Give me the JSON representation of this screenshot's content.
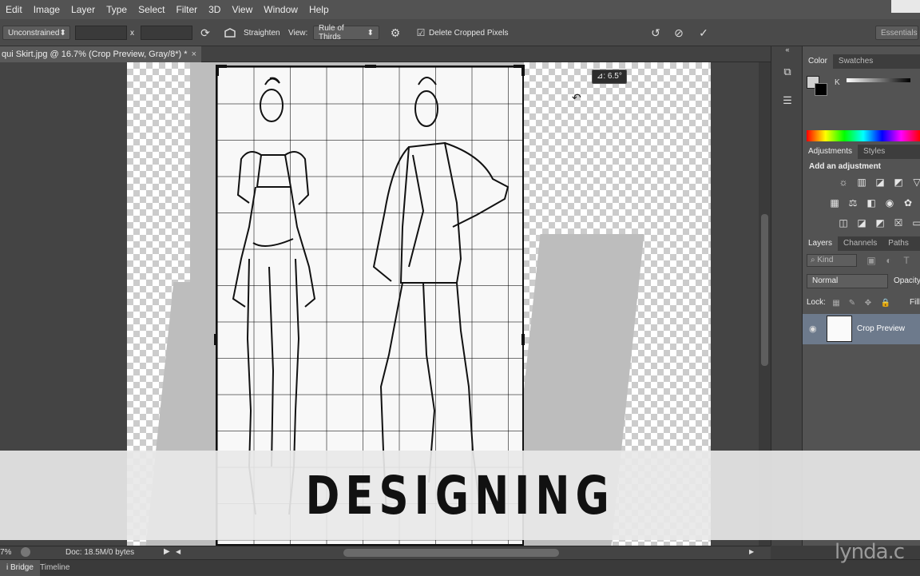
{
  "menu": [
    "Edit",
    "Image",
    "Layer",
    "Type",
    "Select",
    "Filter",
    "3D",
    "View",
    "Window",
    "Help"
  ],
  "options": {
    "ratio": "Unconstrained",
    "ratio_sep": "x",
    "straighten": "Straighten",
    "view_label": "View:",
    "view_value": "Rule of Thirds",
    "delete_cropped": "Delete Cropped Pixels",
    "workspace": "Essentials"
  },
  "document": {
    "tab_title": "qui Skirt.jpg @ 16.7% (Crop Preview, Gray/8*) *",
    "close": "×",
    "angle": "⊿: 6.5°"
  },
  "panels": {
    "color_tabs": [
      "Color",
      "Swatches"
    ],
    "color_channel": "K",
    "adjust_tabs": [
      "Adjustments",
      "Styles"
    ],
    "adjust_title": "Add an adjustment",
    "layer_tabs": [
      "Layers",
      "Channels",
      "Paths"
    ],
    "kind": "Kind",
    "blend_mode": "Normal",
    "opacity_label": "Opacity:",
    "lock_label": "Lock:",
    "fill_label": "Fill:",
    "layer_name": "Crop Preview"
  },
  "status": {
    "zoom": "7%",
    "doc": "Doc: 18.5M/0 bytes"
  },
  "bottom_tabs": [
    "i Bridge",
    "Timeline"
  ],
  "banner": "DESIGNING",
  "watermark": "lynda.c",
  "colors": {
    "menubar": "#535353",
    "panel": "#535353",
    "banner": "#e8e8e8",
    "layer_selected": "#6d7a8c"
  }
}
